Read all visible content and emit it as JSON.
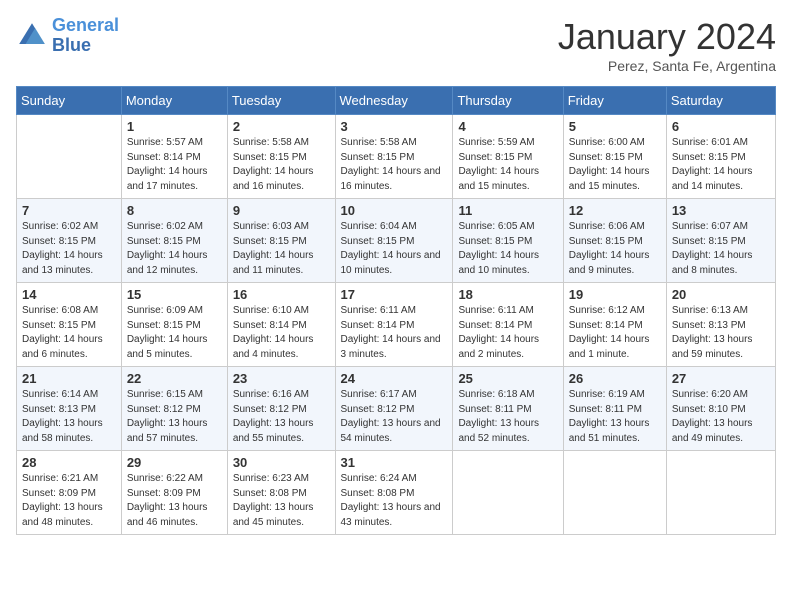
{
  "header": {
    "logo_line1": "General",
    "logo_line2": "Blue",
    "month_title": "January 2024",
    "subtitle": "Perez, Santa Fe, Argentina"
  },
  "days_of_week": [
    "Sunday",
    "Monday",
    "Tuesday",
    "Wednesday",
    "Thursday",
    "Friday",
    "Saturday"
  ],
  "weeks": [
    [
      {
        "day": "",
        "sunrise": "",
        "sunset": "",
        "daylight": ""
      },
      {
        "day": "1",
        "sunrise": "5:57 AM",
        "sunset": "8:14 PM",
        "daylight": "14 hours and 17 minutes."
      },
      {
        "day": "2",
        "sunrise": "5:58 AM",
        "sunset": "8:15 PM",
        "daylight": "14 hours and 16 minutes."
      },
      {
        "day": "3",
        "sunrise": "5:58 AM",
        "sunset": "8:15 PM",
        "daylight": "14 hours and 16 minutes."
      },
      {
        "day": "4",
        "sunrise": "5:59 AM",
        "sunset": "8:15 PM",
        "daylight": "14 hours and 15 minutes."
      },
      {
        "day": "5",
        "sunrise": "6:00 AM",
        "sunset": "8:15 PM",
        "daylight": "14 hours and 15 minutes."
      },
      {
        "day": "6",
        "sunrise": "6:01 AM",
        "sunset": "8:15 PM",
        "daylight": "14 hours and 14 minutes."
      }
    ],
    [
      {
        "day": "7",
        "sunrise": "6:02 AM",
        "sunset": "8:15 PM",
        "daylight": "14 hours and 13 minutes."
      },
      {
        "day": "8",
        "sunrise": "6:02 AM",
        "sunset": "8:15 PM",
        "daylight": "14 hours and 12 minutes."
      },
      {
        "day": "9",
        "sunrise": "6:03 AM",
        "sunset": "8:15 PM",
        "daylight": "14 hours and 11 minutes."
      },
      {
        "day": "10",
        "sunrise": "6:04 AM",
        "sunset": "8:15 PM",
        "daylight": "14 hours and 10 minutes."
      },
      {
        "day": "11",
        "sunrise": "6:05 AM",
        "sunset": "8:15 PM",
        "daylight": "14 hours and 10 minutes."
      },
      {
        "day": "12",
        "sunrise": "6:06 AM",
        "sunset": "8:15 PM",
        "daylight": "14 hours and 9 minutes."
      },
      {
        "day": "13",
        "sunrise": "6:07 AM",
        "sunset": "8:15 PM",
        "daylight": "14 hours and 8 minutes."
      }
    ],
    [
      {
        "day": "14",
        "sunrise": "6:08 AM",
        "sunset": "8:15 PM",
        "daylight": "14 hours and 6 minutes."
      },
      {
        "day": "15",
        "sunrise": "6:09 AM",
        "sunset": "8:15 PM",
        "daylight": "14 hours and 5 minutes."
      },
      {
        "day": "16",
        "sunrise": "6:10 AM",
        "sunset": "8:14 PM",
        "daylight": "14 hours and 4 minutes."
      },
      {
        "day": "17",
        "sunrise": "6:11 AM",
        "sunset": "8:14 PM",
        "daylight": "14 hours and 3 minutes."
      },
      {
        "day": "18",
        "sunrise": "6:11 AM",
        "sunset": "8:14 PM",
        "daylight": "14 hours and 2 minutes."
      },
      {
        "day": "19",
        "sunrise": "6:12 AM",
        "sunset": "8:14 PM",
        "daylight": "14 hours and 1 minute."
      },
      {
        "day": "20",
        "sunrise": "6:13 AM",
        "sunset": "8:13 PM",
        "daylight": "13 hours and 59 minutes."
      }
    ],
    [
      {
        "day": "21",
        "sunrise": "6:14 AM",
        "sunset": "8:13 PM",
        "daylight": "13 hours and 58 minutes."
      },
      {
        "day": "22",
        "sunrise": "6:15 AM",
        "sunset": "8:12 PM",
        "daylight": "13 hours and 57 minutes."
      },
      {
        "day": "23",
        "sunrise": "6:16 AM",
        "sunset": "8:12 PM",
        "daylight": "13 hours and 55 minutes."
      },
      {
        "day": "24",
        "sunrise": "6:17 AM",
        "sunset": "8:12 PM",
        "daylight": "13 hours and 54 minutes."
      },
      {
        "day": "25",
        "sunrise": "6:18 AM",
        "sunset": "8:11 PM",
        "daylight": "13 hours and 52 minutes."
      },
      {
        "day": "26",
        "sunrise": "6:19 AM",
        "sunset": "8:11 PM",
        "daylight": "13 hours and 51 minutes."
      },
      {
        "day": "27",
        "sunrise": "6:20 AM",
        "sunset": "8:10 PM",
        "daylight": "13 hours and 49 minutes."
      }
    ],
    [
      {
        "day": "28",
        "sunrise": "6:21 AM",
        "sunset": "8:09 PM",
        "daylight": "13 hours and 48 minutes."
      },
      {
        "day": "29",
        "sunrise": "6:22 AM",
        "sunset": "8:09 PM",
        "daylight": "13 hours and 46 minutes."
      },
      {
        "day": "30",
        "sunrise": "6:23 AM",
        "sunset": "8:08 PM",
        "daylight": "13 hours and 45 minutes."
      },
      {
        "day": "31",
        "sunrise": "6:24 AM",
        "sunset": "8:08 PM",
        "daylight": "13 hours and 43 minutes."
      },
      {
        "day": "",
        "sunrise": "",
        "sunset": "",
        "daylight": ""
      },
      {
        "day": "",
        "sunrise": "",
        "sunset": "",
        "daylight": ""
      },
      {
        "day": "",
        "sunrise": "",
        "sunset": "",
        "daylight": ""
      }
    ]
  ],
  "labels": {
    "sunrise_prefix": "Sunrise: ",
    "sunset_prefix": "Sunset: ",
    "daylight_prefix": "Daylight: "
  }
}
